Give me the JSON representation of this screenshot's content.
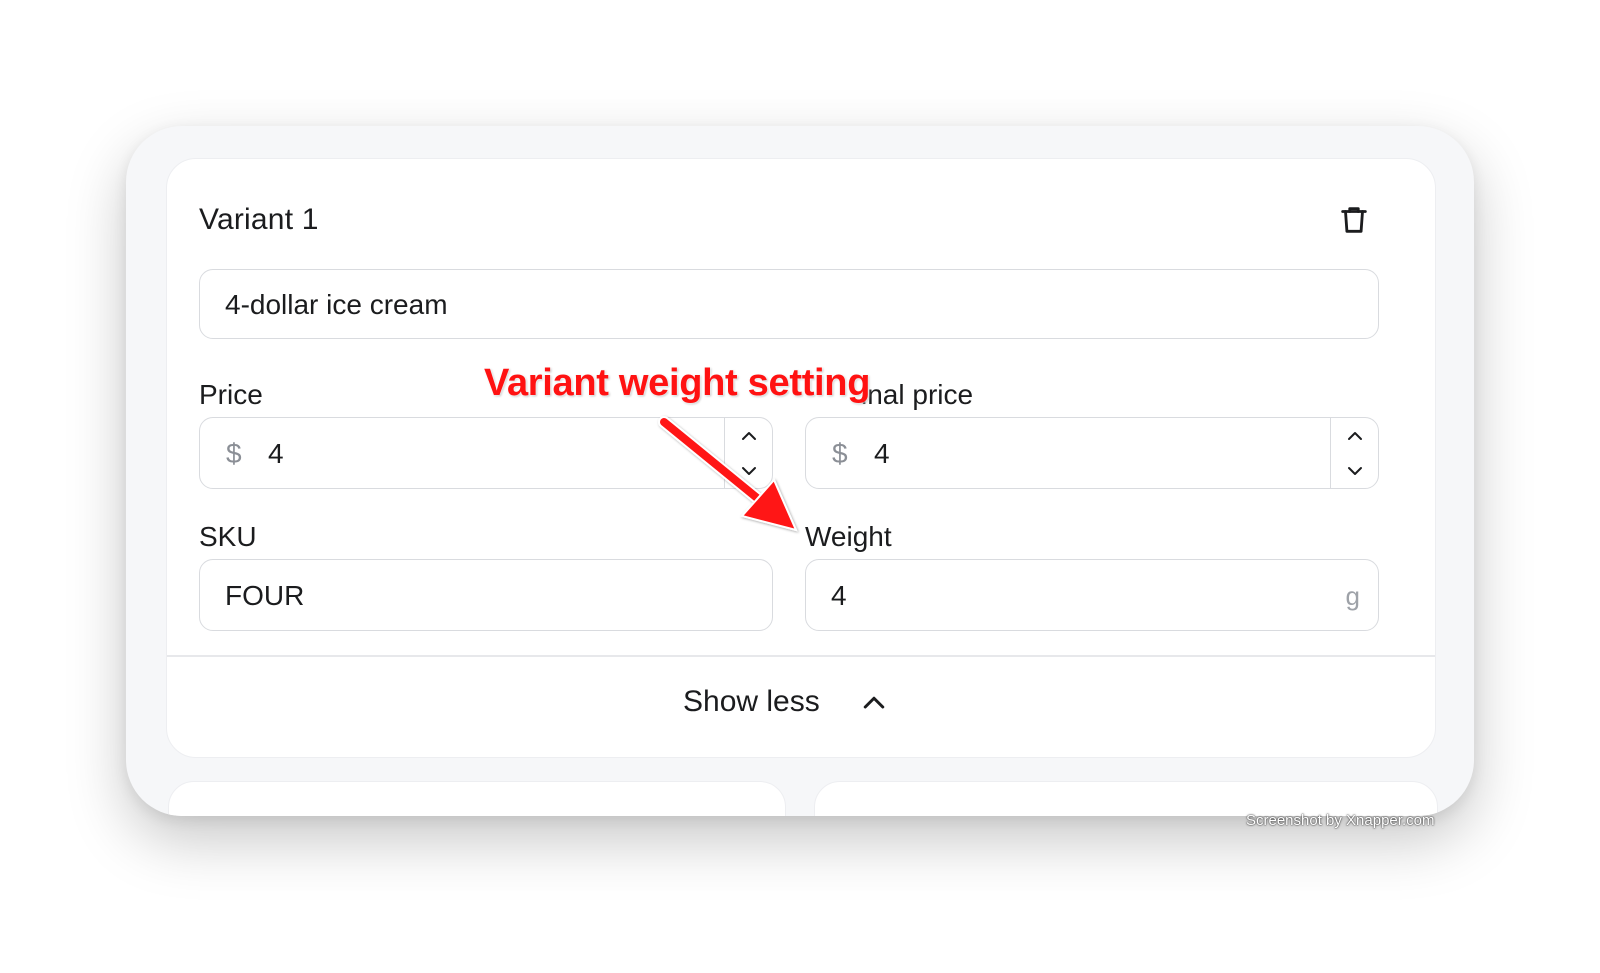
{
  "variant": {
    "title": "Variant 1",
    "name_value": "4-dollar ice cream",
    "price": {
      "label": "Price",
      "currency": "$",
      "value": "4"
    },
    "compare_price": {
      "label": "Original price",
      "label_visible": "inal price",
      "currency": "$",
      "value": "4"
    },
    "sku": {
      "label": "SKU",
      "value": "FOUR"
    },
    "weight": {
      "label": "Weight",
      "value": "4",
      "unit": "g"
    },
    "toggle_label": "Show less"
  },
  "annotation": {
    "text": "Variant weight setting",
    "color": "#ff1212"
  },
  "watermark": "Screenshot by Xnapper.com",
  "icons": {
    "delete": "trash-icon",
    "increment": "chevron-up-icon",
    "decrement": "chevron-down-icon",
    "collapse": "chevron-up-icon"
  }
}
